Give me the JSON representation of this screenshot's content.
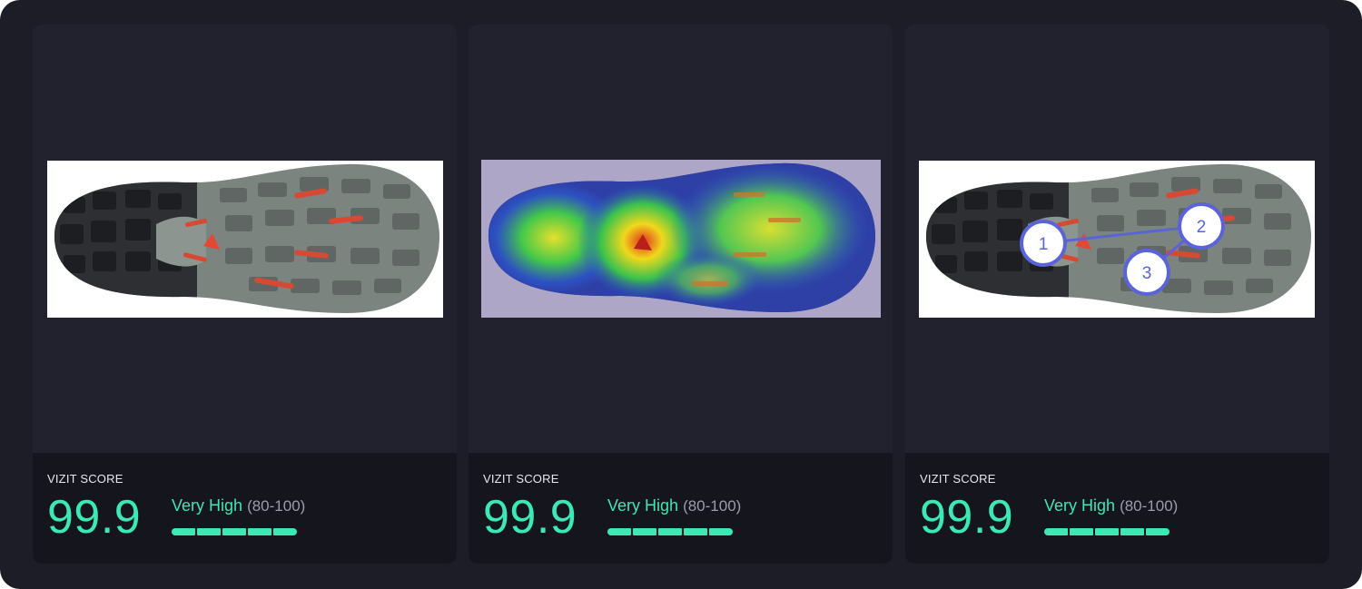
{
  "cards": [
    {
      "view": "original",
      "score_label": "VIZIT SCORE",
      "score": "99.9",
      "level": "Very High",
      "range": "(80-100)"
    },
    {
      "view": "heatmap",
      "score_label": "VIZIT SCORE",
      "score": "99.9",
      "level": "Very High",
      "range": "(80-100)"
    },
    {
      "view": "focus-points",
      "score_label": "VIZIT SCORE",
      "score": "99.9",
      "level": "Very High",
      "range": "(80-100)",
      "markers": [
        "1",
        "2",
        "3"
      ]
    }
  ],
  "colors": {
    "accent": "#3ce8b4",
    "card_bg": "#21222d",
    "footer_bg": "#15161d",
    "marker": "#5a63d8"
  },
  "icons": [
    "shoe-sole-image",
    "heatmap-overlay",
    "focus-marker"
  ]
}
